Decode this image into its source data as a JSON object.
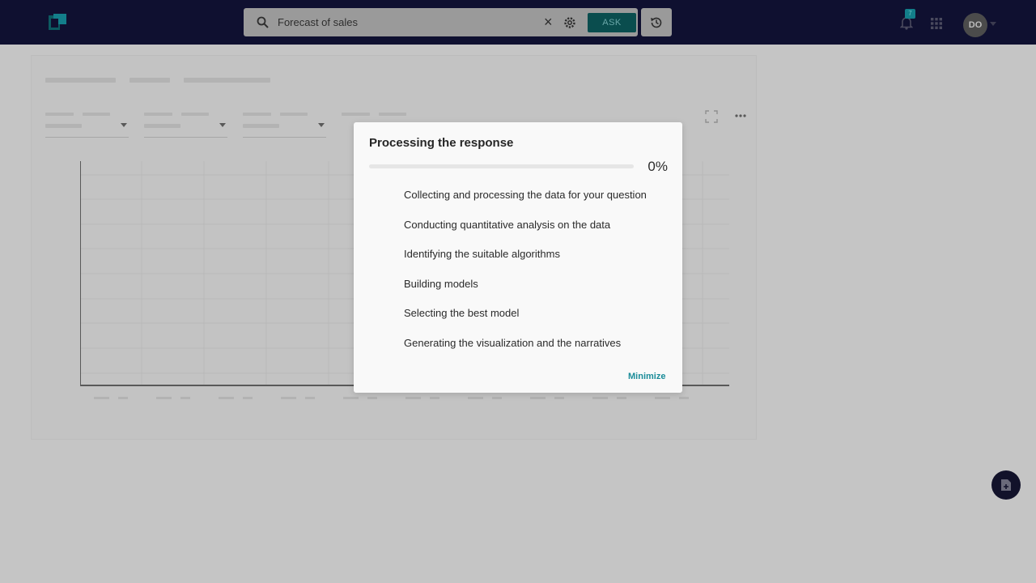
{
  "header": {
    "search": {
      "value": "Forecast of sales"
    },
    "ask_label": "ASK",
    "notification_count": "7",
    "avatar_initials": "DO"
  },
  "modal": {
    "title": "Processing the response",
    "progress": 0,
    "progress_label": "0%",
    "steps": [
      "Collecting and processing the data for your question",
      "Conducting quantitative analysis on the data",
      "Identifying the suitable algorithms",
      "Building models",
      "Selecting the best model",
      "Generating the visualization and the narratives"
    ],
    "minimize_label": "Minimize"
  },
  "colors": {
    "accent": "#1a8c99",
    "topbar": "#0f1030"
  }
}
